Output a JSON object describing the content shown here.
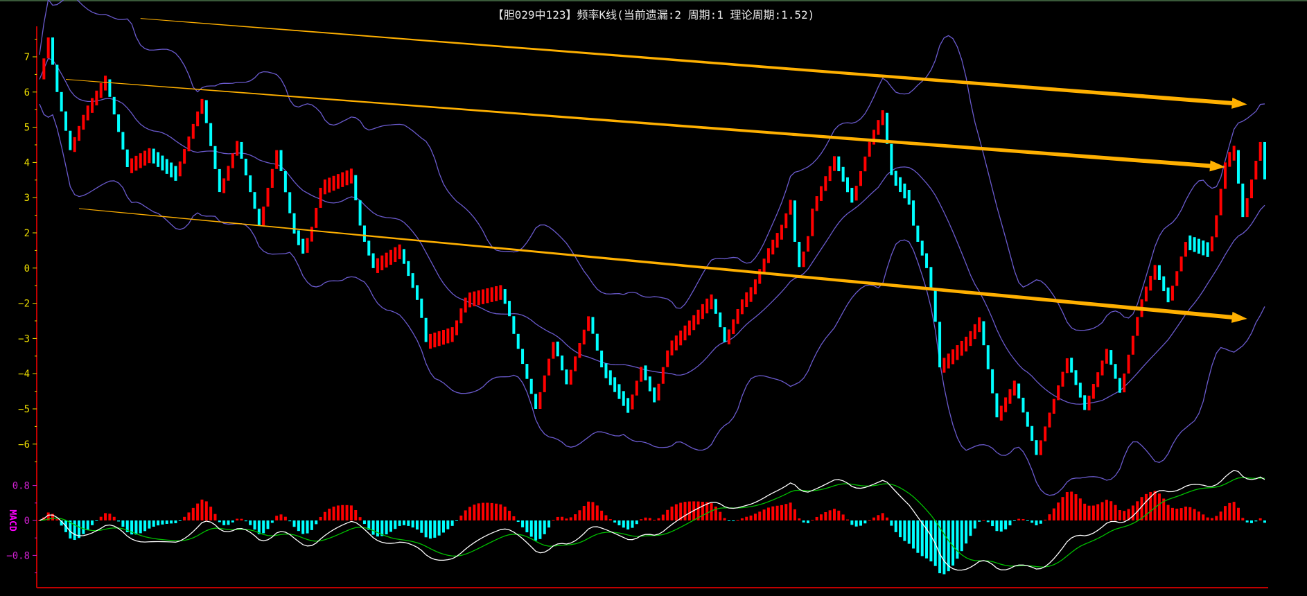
{
  "title": "【胆029中123】频率K线(当前遗漏:2 周期:1 理论周期:1.52)",
  "chart_data": {
    "type": "candlestick",
    "title": "【胆029中123】频率K线(当前遗漏:2 周期:1 理论周期:1.52)",
    "bar_count": 280,
    "y_ticks": [
      7,
      6,
      5,
      4,
      3,
      2,
      0,
      -2,
      -3,
      -4,
      -5,
      -6
    ],
    "up_color": "#ff0000",
    "down_color": "#00ffff",
    "band_color": "#6a5acd",
    "close_path": [
      [
        0,
        6.36
      ],
      [
        2,
        7.55
      ],
      [
        4,
        6.0
      ],
      [
        7,
        4.35
      ],
      [
        10,
        5.3
      ],
      [
        15,
        6.36
      ],
      [
        20,
        3.87
      ],
      [
        25,
        4.23
      ],
      [
        31,
        3.64
      ],
      [
        37,
        5.77
      ],
      [
        41,
        3.16
      ],
      [
        45,
        4.58
      ],
      [
        50,
        2.21
      ],
      [
        54,
        4.35
      ],
      [
        58,
        1.96
      ],
      [
        60,
        1.0
      ],
      [
        64,
        3.28
      ],
      [
        71,
        3.64
      ],
      [
        76,
        0.06
      ],
      [
        82,
        1.0
      ],
      [
        88,
        -3.1
      ],
      [
        94,
        -2.87
      ],
      [
        97,
        -1.84
      ],
      [
        105,
        -1.36
      ],
      [
        108,
        -2.87
      ],
      [
        113,
        -5.0
      ],
      [
        117,
        -3.1
      ],
      [
        120,
        -4.29
      ],
      [
        125,
        -2.39
      ],
      [
        128,
        -3.82
      ],
      [
        134,
        -5.0
      ],
      [
        137,
        -3.82
      ],
      [
        140,
        -4.76
      ],
      [
        143,
        -3.34
      ],
      [
        148,
        -2.63
      ],
      [
        153,
        -1.84
      ],
      [
        156,
        -3.1
      ],
      [
        162,
        -1.36
      ],
      [
        166,
        1.0
      ],
      [
        171,
        2.92
      ],
      [
        173,
        0.06
      ],
      [
        176,
        2.69
      ],
      [
        181,
        4.11
      ],
      [
        185,
        2.92
      ],
      [
        189,
        4.58
      ],
      [
        192,
        5.41
      ],
      [
        194,
        3.64
      ],
      [
        198,
        2.92
      ],
      [
        202,
        0.06
      ],
      [
        205,
        -3.82
      ],
      [
        211,
        -3.1
      ],
      [
        214,
        -2.51
      ],
      [
        218,
        -5.24
      ],
      [
        222,
        -4.29
      ],
      [
        227,
        -6.3
      ],
      [
        230,
        -5.12
      ],
      [
        234,
        -3.58
      ],
      [
        238,
        -5.0
      ],
      [
        243,
        -3.34
      ],
      [
        246,
        -4.53
      ],
      [
        250,
        -2.39
      ],
      [
        254,
        0.06
      ],
      [
        257,
        -1.84
      ],
      [
        261,
        1.48
      ],
      [
        266,
        1.0
      ],
      [
        270,
        4.0
      ],
      [
        272,
        4.35
      ],
      [
        274,
        2.45
      ],
      [
        278,
        4.58
      ],
      [
        279,
        3.52
      ]
    ],
    "trendlines": [
      {
        "from": [
          23,
          8.09
        ],
        "to": [
          275,
          5.65
        ],
        "color": "#ffb000"
      },
      {
        "from": [
          6,
          6.36
        ],
        "to": [
          270,
          3.87
        ],
        "color": "#ffb000"
      },
      {
        "from": [
          9,
          2.69
        ],
        "to": [
          275,
          -2.44
        ],
        "color": "#ffb000"
      }
    ],
    "bollinger": {
      "period": 20,
      "width": 2
    },
    "macd": {
      "label": "MACD",
      "y_ticks": [
        "0.8",
        "0",
        "-0.8"
      ],
      "fast": 12,
      "slow": 26,
      "signal": 9,
      "dif_color": "#ffffff",
      "dea_color": "#00c000"
    }
  }
}
